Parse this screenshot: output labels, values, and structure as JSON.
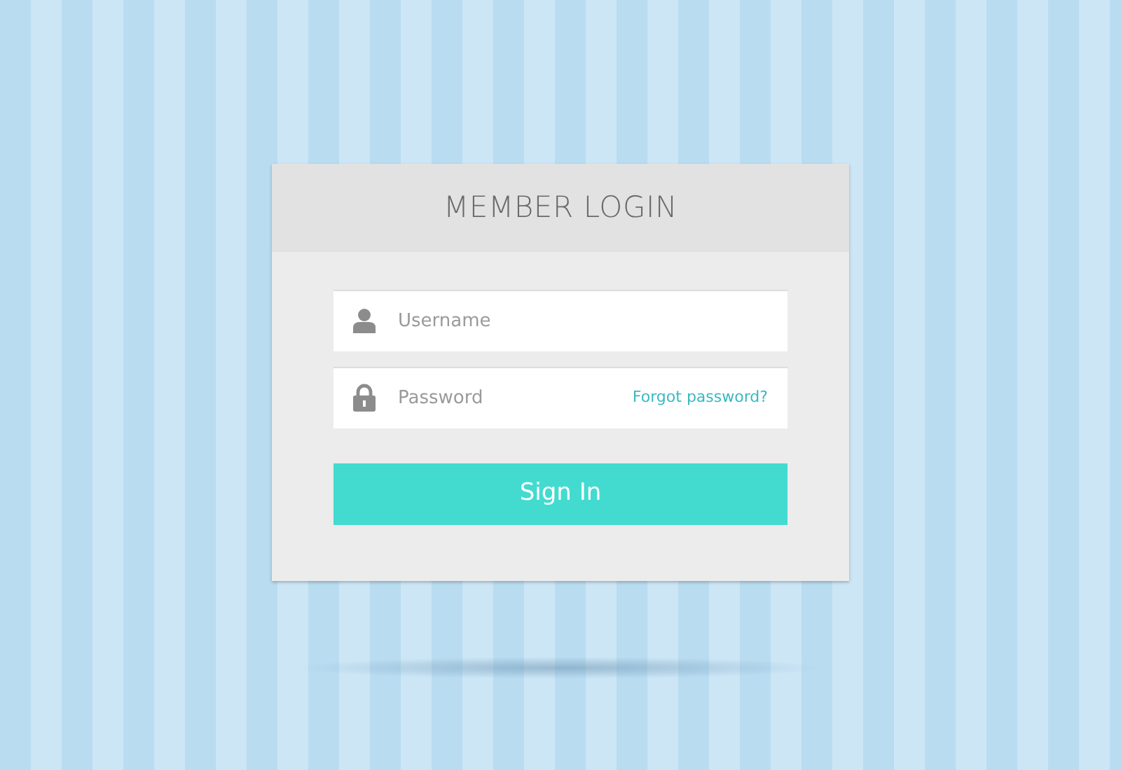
{
  "login": {
    "title": "MEMBER LOGIN",
    "fields": [
      {
        "kind": "username",
        "placeholder": "Username"
      },
      {
        "kind": "password",
        "placeholder": "Password",
        "link": "Forgot password?"
      }
    ],
    "button": "Sign In"
  }
}
